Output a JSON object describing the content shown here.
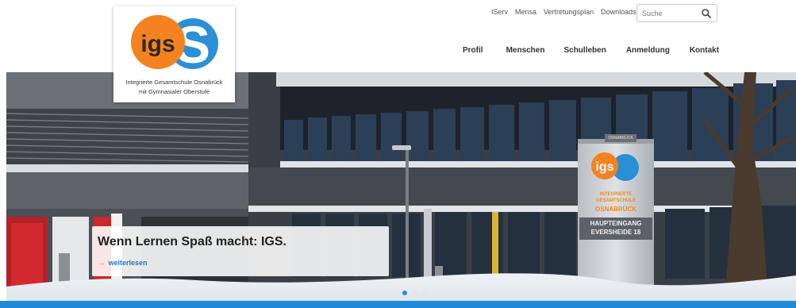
{
  "header": {
    "top_links": [
      "IServ",
      "Mensa",
      "Vertretungsplan",
      "Downloads"
    ],
    "search_placeholder": "Suche",
    "nav": [
      "Profil",
      "Menschen",
      "Schulleben",
      "Anmeldung",
      "Kontakt"
    ]
  },
  "logo": {
    "mark_text": "igs",
    "mark_letter": "S",
    "line1": "Integrierte Gesamtschule Osnabrück",
    "line2": "mit Gymnasialer Oberstufe"
  },
  "hero": {
    "caption_title": "Wenn Lernen Spaß macht: IGS.",
    "caption_link": "weiterlesen",
    "caption_arrow": "→",
    "sign": {
      "top_label": "OSNABRÜCK",
      "logo_text": "igs",
      "orange_text": "INTEGRIERTE GESAMTSCHULE",
      "city": "OSNABRÜCK",
      "entrance_line1": "HAUPTEINGANG",
      "entrance_line2": "EVERSHEIDE 18"
    }
  },
  "slider": {
    "dots": 3,
    "active_index": 0
  },
  "colors": {
    "accent_blue": "#1f8ad8",
    "logo_orange": "#f58220",
    "logo_blue": "#2b8fd6",
    "link_blue": "#1e7ac6"
  }
}
